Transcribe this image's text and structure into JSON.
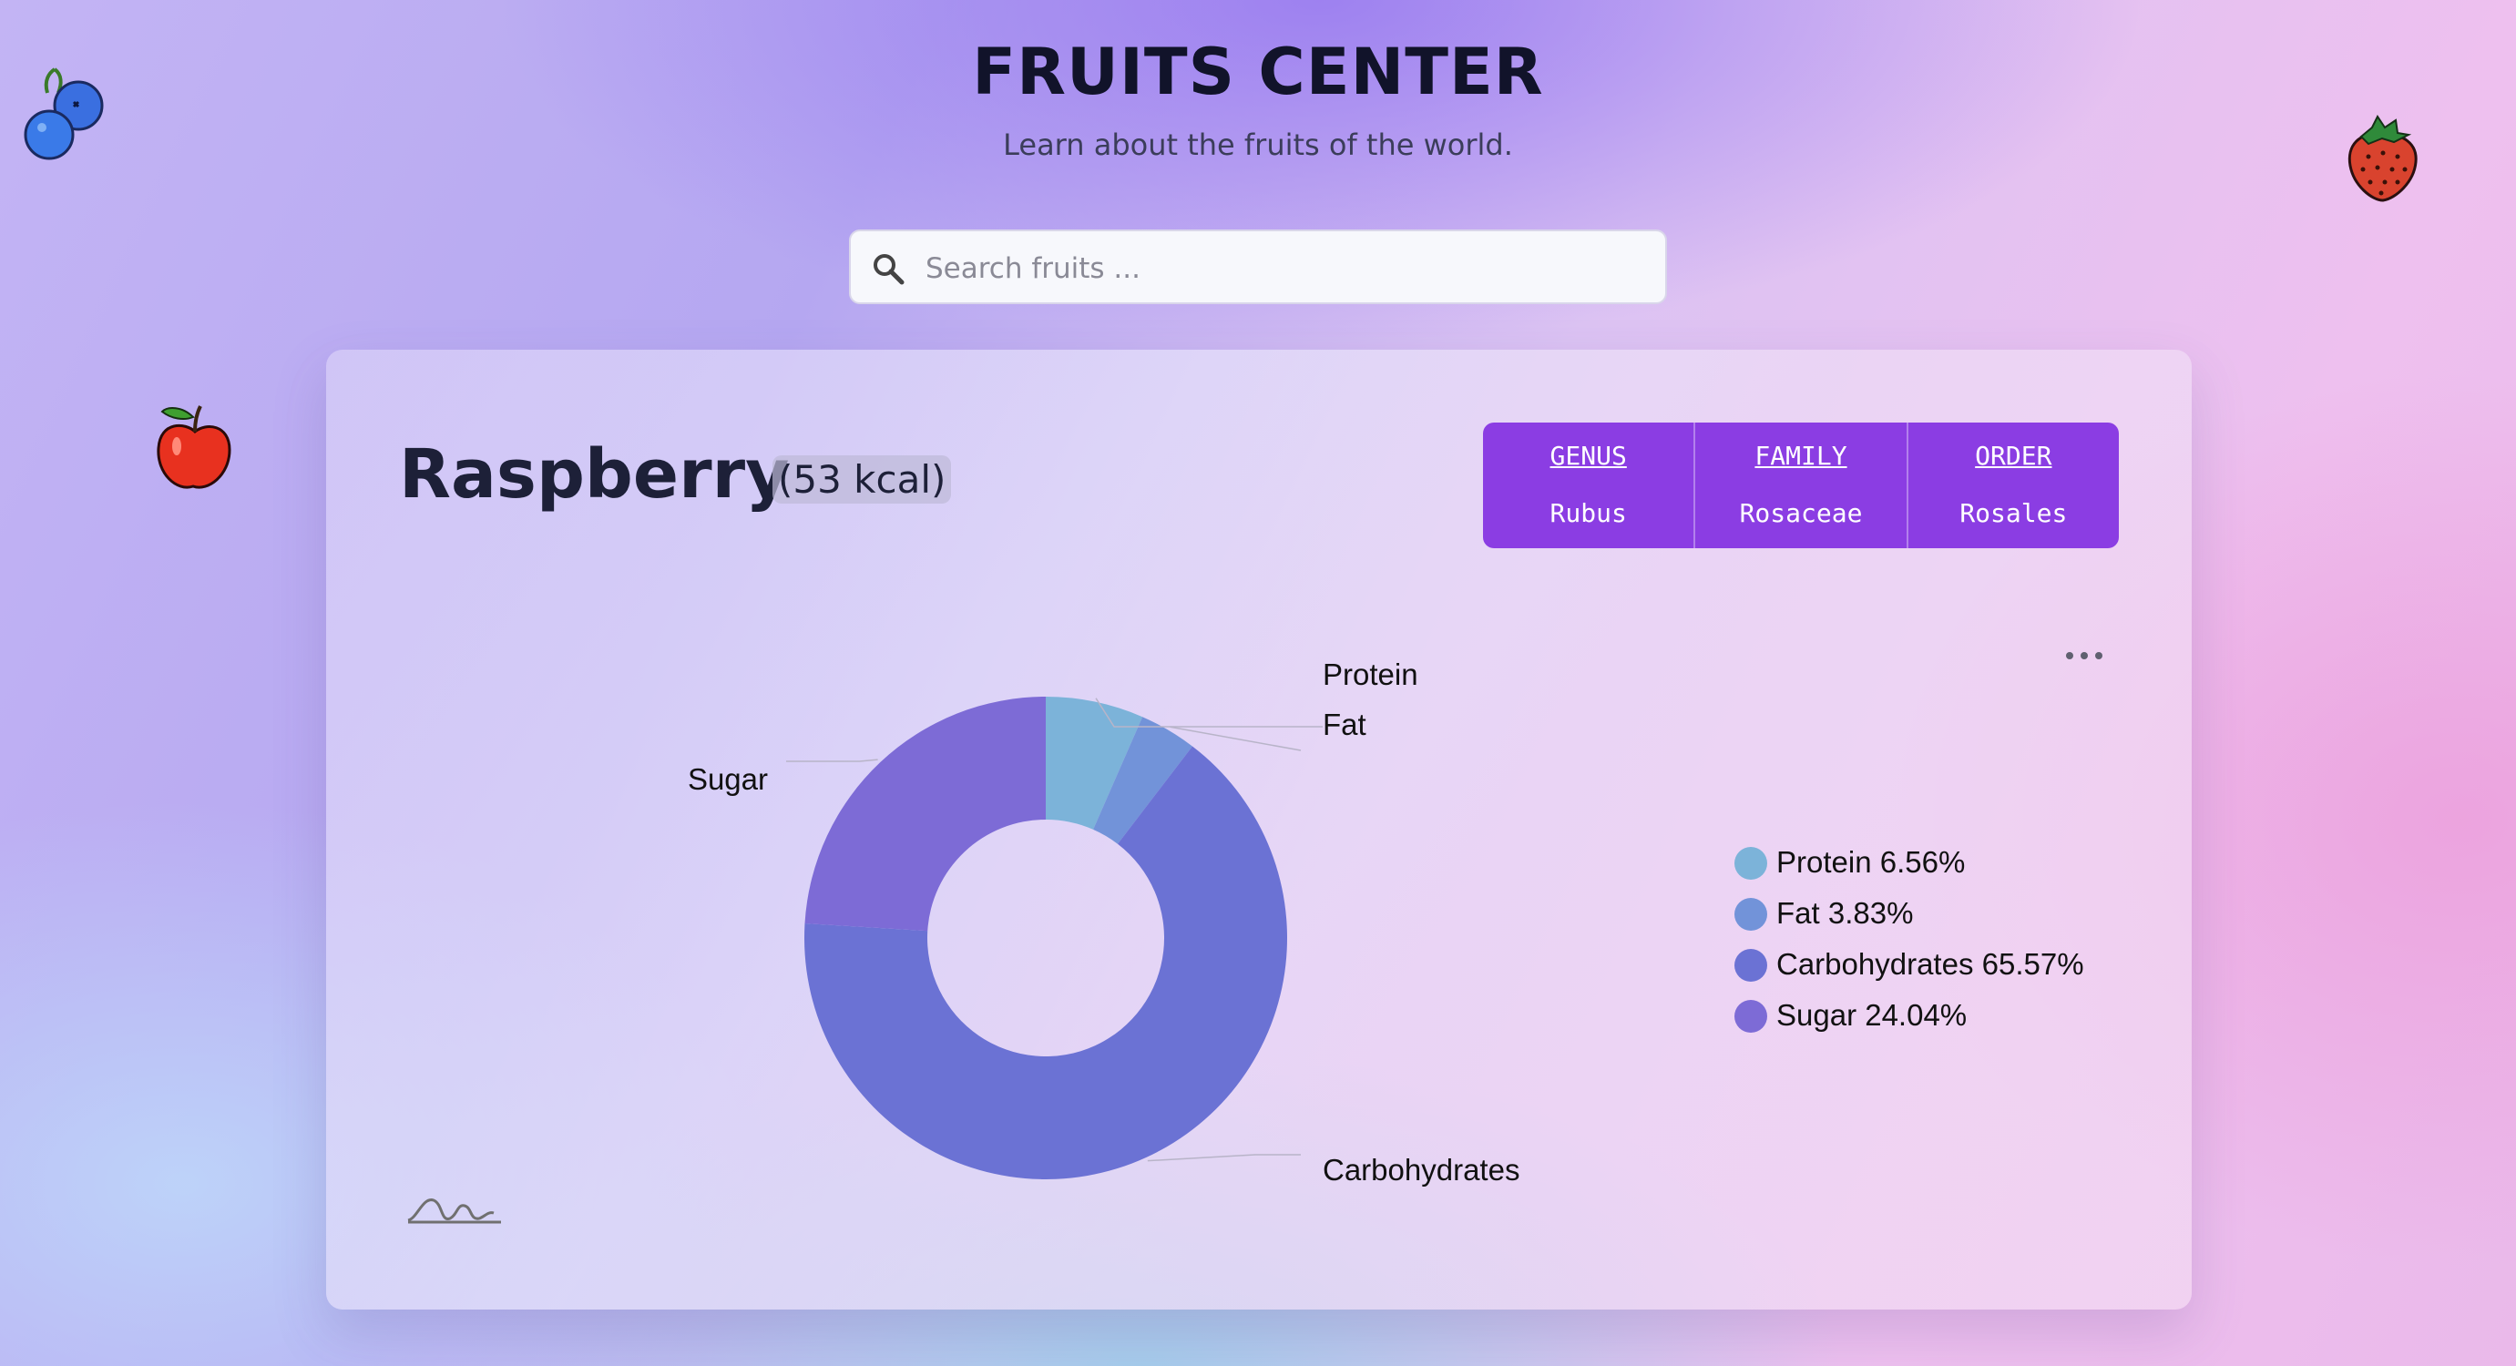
{
  "header": {
    "title": "FRUITS CENTER",
    "subtitle": "Learn about the fruits of the world."
  },
  "search": {
    "placeholder": "Search fruits ...",
    "icon": "search-icon"
  },
  "decorations": [
    "blueberry-icon",
    "strawberry-icon",
    "apple-icon"
  ],
  "fruit": {
    "name": "Raspberry",
    "calories": "(53 kcal)",
    "taxonomy": [
      {
        "key": "GENUS",
        "value": "Rubus"
      },
      {
        "key": "FAMILY",
        "value": "Rosaceae"
      },
      {
        "key": "ORDER",
        "value": "Rosales"
      }
    ]
  },
  "colors": {
    "accent": "#8b3de3",
    "protein": "#7cb3d9",
    "fat": "#7293d9",
    "carbohydrates": "#6b72d4",
    "sugar": "#7d6bd6"
  },
  "chart_data": {
    "type": "pie",
    "donut": true,
    "categories": [
      "Protein",
      "Fat",
      "Carbohydrates",
      "Sugar"
    ],
    "values": [
      6.56,
      3.83,
      65.57,
      24.04
    ],
    "legend": [
      "Protein 6.56%",
      "Fat 3.83%",
      "Carbohydrates 65.57%",
      "Sugar 24.04%"
    ],
    "legend_position": "right",
    "colors": [
      "#7cb3d9",
      "#7293d9",
      "#6b72d4",
      "#7d6bd6"
    ]
  },
  "chart_menu_icon": "more-dots-icon",
  "chart_logo_icon": "echarts-logo-icon"
}
